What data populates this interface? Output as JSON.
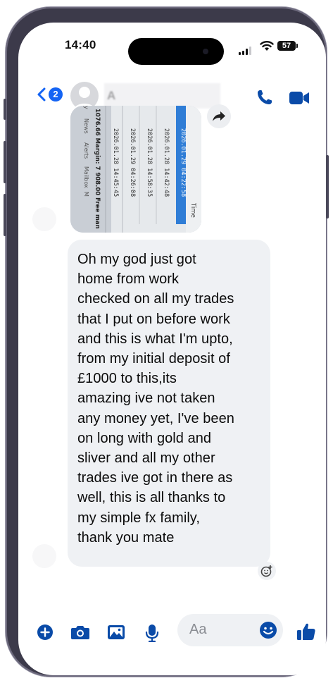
{
  "status_bar": {
    "time": "14:40",
    "battery": "57"
  },
  "header": {
    "unread_count": "2",
    "contact_name": "A",
    "icons": {
      "back": "chevron-left-icon",
      "call": "phone-icon",
      "video": "video-camera-icon"
    }
  },
  "photo": {
    "column_header": "Time",
    "rows": [
      "2026.01.29 04:22:58",
      "2026.01.28 14:42:48",
      "2026.01.28 14:58:35",
      "2026.01.29 04:26:08",
      "2026.01.28 14:45:45"
    ],
    "footer": "1076.66  Margin: 7 908.00  Free man",
    "tabs": [
      "y",
      "News",
      "Alerts",
      "Mailbox",
      "M"
    ]
  },
  "message": {
    "lines": [
      "Oh my god just got",
      "home from work",
      "checked on all my trades",
      "that I put on before work",
      "and this is what I'm upto,",
      "from my initial deposit of",
      "£1000 to this,its",
      "amazing ive not taken",
      "any money yet, I've been",
      "on long with gold and",
      "sliver and all my other",
      "trades ive got in there as",
      "well, this is all thanks to",
      "my simple fx family,",
      "thank you mate"
    ]
  },
  "composer": {
    "placeholder": "Aa",
    "icons": [
      "plus-icon",
      "camera-icon",
      "gallery-icon",
      "microphone-icon",
      "emoji-icon",
      "thumbs-up-icon"
    ]
  },
  "colors": {
    "accent": "#1464f4",
    "messenger_blue": "#0a4ba8",
    "bubble": "#eff1f4"
  }
}
